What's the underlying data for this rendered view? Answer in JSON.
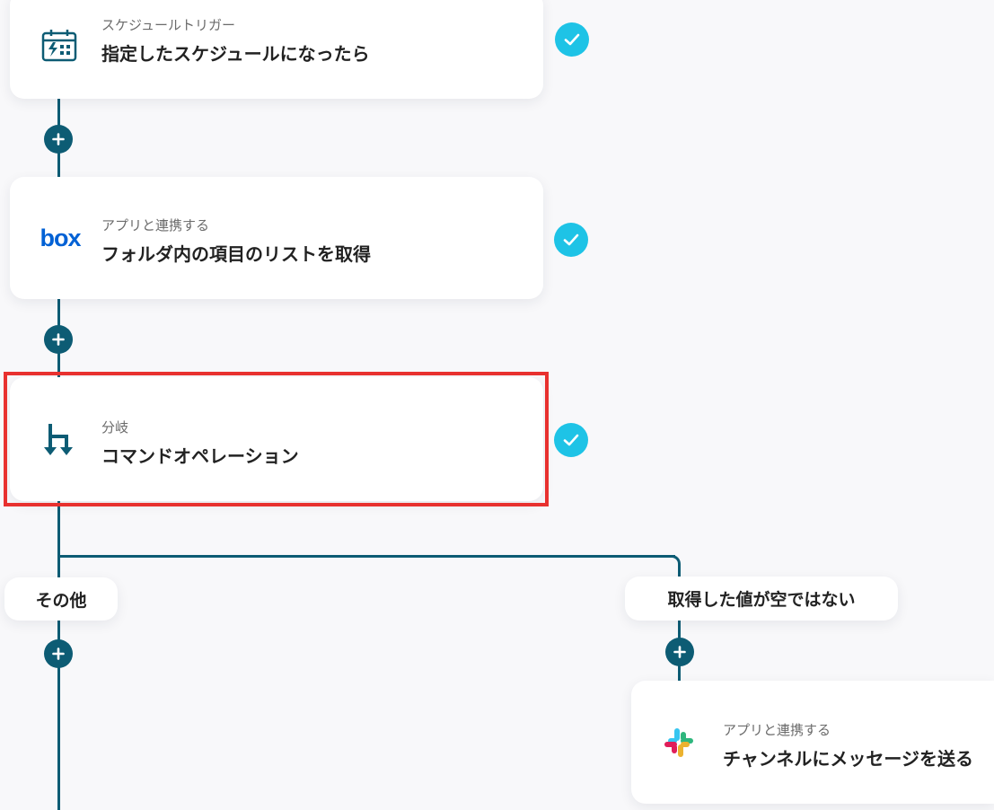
{
  "steps": [
    {
      "subtitle": "スケジュールトリガー",
      "title": "指定したスケジュールになったら",
      "icon": "calendar-lightning-icon",
      "completed": true
    },
    {
      "subtitle": "アプリと連携する",
      "title": "フォルダ内の項目のリストを取得",
      "icon": "box-logo-icon",
      "completed": true
    },
    {
      "subtitle": "分岐",
      "title": "コマンドオペレーション",
      "icon": "branch-icon",
      "completed": true,
      "highlighted": true
    }
  ],
  "branches": [
    {
      "label": "その他"
    },
    {
      "label": "取得した値が空ではない"
    }
  ],
  "branch_step": {
    "subtitle": "アプリと連携する",
    "title": "チャンネルにメッセージを送る",
    "icon": "slack-logo-icon"
  },
  "box_logo_text": "box",
  "colors": {
    "flow_line": "#0d5c74",
    "check": "#1ec3e6",
    "highlight": "#e8312f",
    "box_blue": "#0061d5"
  }
}
